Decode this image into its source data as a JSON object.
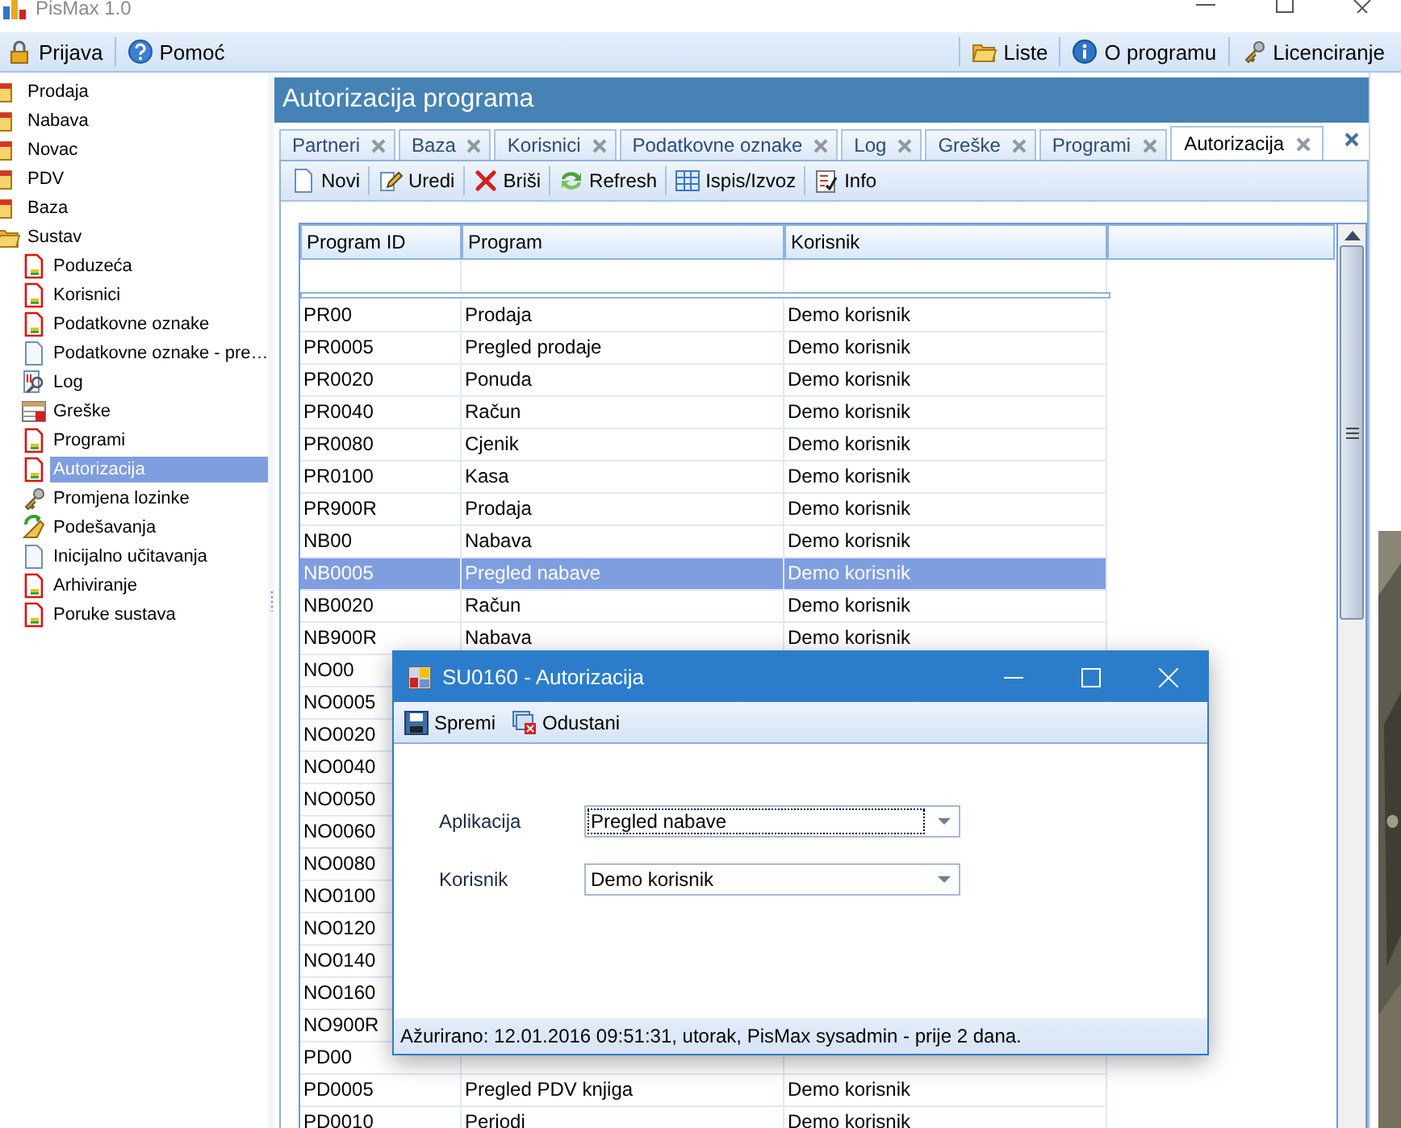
{
  "window": {
    "title": "PisMax 1.0"
  },
  "menu_left": [
    {
      "label": "Prijava",
      "kind": "lock"
    },
    {
      "label": "Pomoć",
      "kind": "help"
    }
  ],
  "menu_right": [
    {
      "label": "Liste",
      "kind": "folder"
    },
    {
      "label": "O programu",
      "kind": "info"
    },
    {
      "label": "Licenciranje",
      "kind": "keys"
    }
  ],
  "sidebar": {
    "items": [
      {
        "label": "Prodaja",
        "kind": "module",
        "selected": false
      },
      {
        "label": "Nabava",
        "kind": "module",
        "selected": false
      },
      {
        "label": "Novac",
        "kind": "module",
        "selected": false
      },
      {
        "label": "PDV",
        "kind": "module",
        "selected": false
      },
      {
        "label": "Baza",
        "kind": "module",
        "selected": false
      },
      {
        "label": "Sustav",
        "kind": "folder",
        "selected": false,
        "expanded": true,
        "children": [
          {
            "label": "Poduzeća",
            "kind": "form",
            "selected": false
          },
          {
            "label": "Korisnici",
            "kind": "form",
            "selected": false
          },
          {
            "label": "Podatkovne oznake",
            "kind": "form",
            "selected": false
          },
          {
            "label": "Podatkovne oznake - pre…",
            "kind": "blank",
            "selected": false
          },
          {
            "label": "Log",
            "kind": "log",
            "selected": false
          },
          {
            "label": "Greške",
            "kind": "errors",
            "selected": false
          },
          {
            "label": "Programi",
            "kind": "form",
            "selected": false
          },
          {
            "label": "Autorizacija",
            "kind": "form",
            "selected": true
          },
          {
            "label": "Promjena lozinke",
            "kind": "keys",
            "selected": false
          },
          {
            "label": "Podešavanja",
            "kind": "settings",
            "selected": false
          },
          {
            "label": "Inicijalno učitavanja",
            "kind": "blank",
            "selected": false
          },
          {
            "label": "Arhiviranje",
            "kind": "form",
            "selected": false
          },
          {
            "label": "Poruke sustava",
            "kind": "form",
            "selected": false
          }
        ]
      }
    ]
  },
  "heading": "Autorizacija programa",
  "tabs": [
    {
      "label": "Partneri",
      "selected": false
    },
    {
      "label": "Baza",
      "selected": false
    },
    {
      "label": "Korisnici",
      "selected": false
    },
    {
      "label": "Podatkovne oznake",
      "selected": false
    },
    {
      "label": "Log",
      "selected": false
    },
    {
      "label": "Greške",
      "selected": false
    },
    {
      "label": "Programi",
      "selected": false
    },
    {
      "label": "Autorizacija",
      "selected": true
    }
  ],
  "toolbar": [
    {
      "label": "Novi",
      "kind": "new"
    },
    {
      "label": "Uredi",
      "kind": "edit"
    },
    {
      "label": "Briši",
      "kind": "delete"
    },
    {
      "label": "Refresh",
      "kind": "refresh"
    },
    {
      "label": "Ispis/Izvoz",
      "kind": "table"
    },
    {
      "label": "Info",
      "kind": "checklist"
    }
  ],
  "table": {
    "columns": [
      "Program ID",
      "Program",
      "Korisnik"
    ],
    "rows": [
      {
        "program_id": "PR00",
        "program": "Prodaja",
        "user": "Demo korisnik",
        "selected": false
      },
      {
        "program_id": "PR0005",
        "program": "Pregled prodaje",
        "user": "Demo korisnik",
        "selected": false
      },
      {
        "program_id": "PR0020",
        "program": "Ponuda",
        "user": "Demo korisnik",
        "selected": false
      },
      {
        "program_id": "PR0040",
        "program": "Račun",
        "user": "Demo korisnik",
        "selected": false
      },
      {
        "program_id": "PR0080",
        "program": "Cjenik",
        "user": "Demo korisnik",
        "selected": false
      },
      {
        "program_id": "PR0100",
        "program": "Kasa",
        "user": "Demo korisnik",
        "selected": false
      },
      {
        "program_id": "PR900R",
        "program": "Prodaja",
        "user": "Demo korisnik",
        "selected": false
      },
      {
        "program_id": "NB00",
        "program": "Nabava",
        "user": "Demo korisnik",
        "selected": false
      },
      {
        "program_id": "NB0005",
        "program": "Pregled nabave",
        "user": "Demo korisnik",
        "selected": true
      },
      {
        "program_id": "NB0020",
        "program": "Račun",
        "user": "Demo korisnik",
        "selected": false
      },
      {
        "program_id": "NB900R",
        "program": "Nabava",
        "user": "Demo korisnik",
        "selected": false
      },
      {
        "program_id": "NO00",
        "selected": false
      },
      {
        "program_id": "NO0005",
        "selected": false
      },
      {
        "program_id": "NO0020",
        "selected": false
      },
      {
        "program_id": "NO0040",
        "selected": false
      },
      {
        "program_id": "NO0050",
        "selected": false
      },
      {
        "program_id": "NO0060",
        "selected": false
      },
      {
        "program_id": "NO0080",
        "selected": false
      },
      {
        "program_id": "NO0100",
        "selected": false
      },
      {
        "program_id": "NO0120",
        "selected": false
      },
      {
        "program_id": "NO0140",
        "selected": false
      },
      {
        "program_id": "NO0160",
        "selected": false
      },
      {
        "program_id": "NO900R",
        "selected": false
      },
      {
        "program_id": "PD00",
        "selected": false
      },
      {
        "program_id": "PD0005",
        "program": "Pregled PDV knjiga",
        "user": "Demo korisnik",
        "selected": false
      },
      {
        "program_id": "PD0010",
        "program": "Periodi",
        "user": "Demo korisnik",
        "selected": false
      }
    ]
  },
  "dialog": {
    "title": "SU0160 - Autorizacija",
    "toolbar": [
      {
        "label": "Spremi",
        "kind": "save"
      },
      {
        "label": "Odustani",
        "kind": "cancel"
      }
    ],
    "fields": [
      {
        "label": "Aplikacija",
        "value": "Pregled nabave",
        "focused": true
      },
      {
        "label": "Korisnik",
        "value": "Demo korisnik",
        "focused": false
      }
    ],
    "status": "Ažurirano: 12.01.2016 09:51:31, utorak, PisMax sysadmin -  prije 2 dana."
  }
}
